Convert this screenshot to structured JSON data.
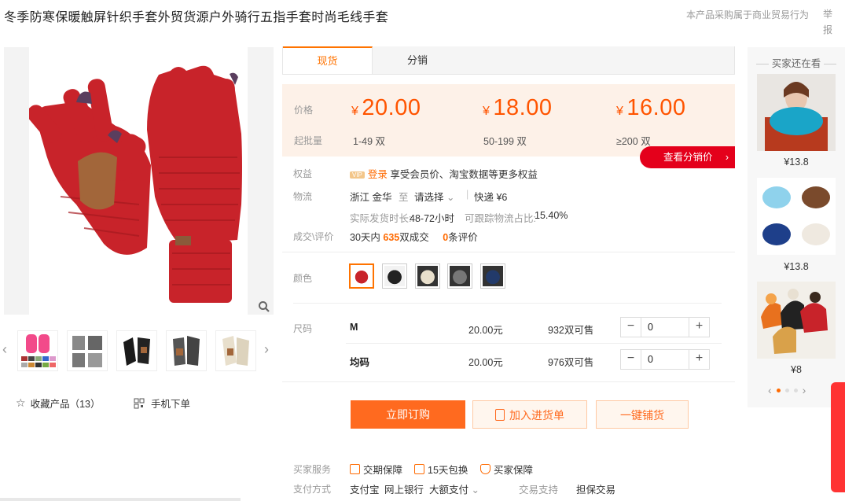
{
  "title": "冬季防寒保暖触屏针织手套外贸货源户外骑行五指手套时尚毛线手套",
  "report_note": "本产品采购属于商业贸易行为",
  "report_link": "举报",
  "tabs": [
    "现货",
    "分销"
  ],
  "price_label": "价格",
  "batch_label": "起批量",
  "currency": "¥",
  "tiers": [
    {
      "price": "20.00",
      "range": "1-49 双"
    },
    {
      "price": "18.00",
      "range": "50-199 双"
    },
    {
      "price": "16.00",
      "range": "≥200 双"
    }
  ],
  "dist_btn": "查看分销价",
  "rights": {
    "label": "权益",
    "vip": "VIP",
    "login": "登录",
    "text": "享受会员价、淘宝数据等更多权益"
  },
  "logistics": {
    "label": "物流",
    "from": "浙江 金华",
    "to": "至",
    "select": "请选择",
    "express": "快递 ¥6",
    "ship_time_label": "实际发货时长:",
    "ship_time": "48-72小时",
    "track_label": "可跟踪物流占比:",
    "track": "15.40%"
  },
  "deal": {
    "label": "成交\\评价",
    "days": "30天内",
    "count": "635",
    "count_unit": "双成交",
    "reviews": "0",
    "reviews_unit": "条评价"
  },
  "color_label": "颜色",
  "size_label": "尺码",
  "sizes": [
    {
      "name": "M",
      "price": "20.00元",
      "stock": "932双可售",
      "qty": "0"
    },
    {
      "name": "均码",
      "price": "20.00元",
      "stock": "976双可售",
      "qty": "0"
    }
  ],
  "buttons": {
    "buy": "立即订购",
    "cart": "加入进货单",
    "ship": "一键铺货"
  },
  "services": {
    "label": "买家服务",
    "items": [
      "交期保障",
      "15天包换",
      "买家保障"
    ]
  },
  "payment": {
    "label": "支付方式",
    "items": [
      "支付宝",
      "网上银行",
      "大额支付"
    ],
    "trade_label": "交易支持",
    "trade": "担保交易"
  },
  "favorite": "收藏产品（13）",
  "mobile_order": "手机下单",
  "right_col": {
    "title": "买家还在看",
    "prices": [
      "¥13.8",
      "¥13.8",
      "¥8"
    ]
  },
  "colors": {
    "accent": "#ff6a00",
    "price": "#ff5400",
    "red_btn": "#e4001b"
  }
}
